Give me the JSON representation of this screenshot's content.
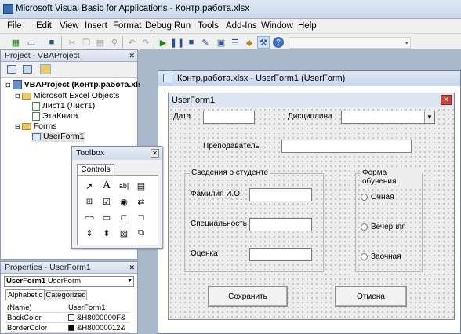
{
  "window": {
    "title": "Microsoft Visual Basic for Applications - Контр.работа.xlsx"
  },
  "menu": [
    "File",
    "Edit",
    "View",
    "Insert",
    "Format",
    "Debug",
    "Run",
    "Tools",
    "Add-Ins",
    "Window",
    "Help"
  ],
  "project": {
    "title": "Project - VBAProject",
    "root": "VBAProject (Контр.работа.xls",
    "excel_objects": "Microsoft Excel Objects",
    "sheet1": "Лист1 (Лист1)",
    "workbook": "ЭтаКнига",
    "forms": "Forms",
    "userform": "UserForm1"
  },
  "designer": {
    "title": "Контр.работа.xlsx - UserForm1 (UserForm)"
  },
  "userform": {
    "caption": "UserForm1",
    "label_date": "Дата",
    "label_discipline": "Дисциплина",
    "label_teacher": "Преподаватель",
    "frame_student": "Сведения о студенте",
    "label_name": "Фамилия И.О.",
    "label_specialty": "Специальность",
    "label_grade": "Оценка",
    "frame_study": "Форма обучения",
    "opt_fulltime": "Очная",
    "opt_evening": "Вечерняя",
    "opt_correspondence": "Заочная",
    "btn_save": "Сохранить",
    "btn_cancel": "Отмена"
  },
  "toolbox": {
    "title": "Toolbox",
    "tab": "Controls"
  },
  "properties": {
    "title": "Properties - UserForm1",
    "object": "UserForm1",
    "object_type": "UserForm",
    "tab_alpha": "Alphabetic",
    "tab_cat": "Categorized",
    "rows": [
      {
        "k": "(Name)",
        "v": "UserForm1"
      },
      {
        "k": "BackColor",
        "v": "&H8000000F&"
      },
      {
        "k": "BorderColor",
        "v": "&H80000012&"
      }
    ]
  },
  "colors": {
    "form_bg": "#ededed",
    "workspace": "#aab8cc",
    "titlebar": "#c9d8ea"
  }
}
